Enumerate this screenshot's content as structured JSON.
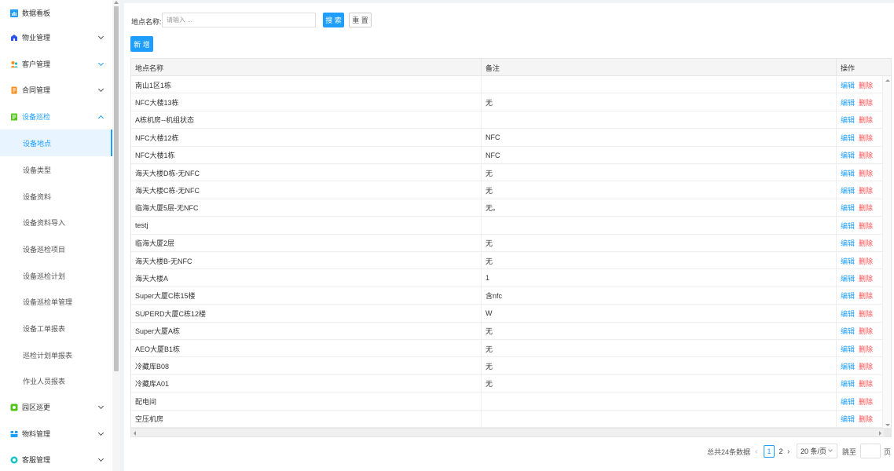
{
  "sidebar": {
    "items": [
      {
        "label": "数据看板",
        "icon": "chart-icon",
        "color": "#1e9fff",
        "chevron": "none"
      },
      {
        "label": "物业管理",
        "icon": "building-icon",
        "color": "#2f54eb",
        "chevron": "down"
      },
      {
        "label": "客户管理",
        "icon": "users-icon",
        "color": "#13c2c2",
        "chevron": "down"
      },
      {
        "label": "合同管理",
        "icon": "contract-icon",
        "color": "#fa8c16",
        "chevron": "down"
      },
      {
        "label": "设备巡检",
        "icon": "inspect-icon",
        "color": "#52c41a",
        "chevron": "up"
      }
    ],
    "sub_items": [
      {
        "label": "设备地点",
        "active": true
      },
      {
        "label": "设备类型"
      },
      {
        "label": "设备资料"
      },
      {
        "label": "设备资料导入"
      },
      {
        "label": "设备巡检项目"
      },
      {
        "label": "设备巡检计划"
      },
      {
        "label": "设备巡检单管理"
      },
      {
        "label": "设备工单报表"
      },
      {
        "label": "巡检计划单报表"
      },
      {
        "label": "作业人员报表"
      }
    ],
    "bottom_items": [
      {
        "label": "园区巡更",
        "icon": "patrol-icon",
        "color": "#52c41a"
      },
      {
        "label": "物料管理",
        "icon": "material-icon",
        "color": "#1e9fff"
      },
      {
        "label": "客服管理",
        "icon": "service-icon",
        "color": "#13c2c2"
      }
    ]
  },
  "search": {
    "label": "地点名称:",
    "placeholder": "请输入 ...",
    "search_button": "搜 索",
    "reset_button": "重 置"
  },
  "toolbar": {
    "add_button": "新 增"
  },
  "table": {
    "headers": [
      "地点名称",
      "备注",
      "操作"
    ],
    "edit_label": "编辑",
    "delete_label": "删除",
    "rows": [
      [
        "南山1区1栋",
        ""
      ],
      [
        "NFC大楼13栋",
        "无"
      ],
      [
        "A栋机房--机组状态",
        ""
      ],
      [
        "NFC大楼12栋",
        "NFC"
      ],
      [
        "NFC大楼1栋",
        "NFC"
      ],
      [
        "海天大楼D栋-无NFC",
        "无"
      ],
      [
        "海天大楼C栋-无NFC",
        "无"
      ],
      [
        "临海大厦5层-无NFC",
        "无。"
      ],
      [
        "testj",
        ""
      ],
      [
        "临海大厦2层",
        "无"
      ],
      [
        "海天大楼B-无NFC",
        "无"
      ],
      [
        "海天大楼A",
        "1"
      ],
      [
        "Super大厦C栋15楼",
        "含nfc"
      ],
      [
        "SUPERD大厦C栋12楼",
        "W"
      ],
      [
        "Super大厦A栋",
        "无"
      ],
      [
        "AEO大厦B1栋",
        "无"
      ],
      [
        "冷藏库B08",
        "无"
      ],
      [
        "冷藏库A01",
        "无"
      ],
      [
        "配电间",
        ""
      ],
      [
        "空压机房",
        ""
      ]
    ]
  },
  "pagination": {
    "total_text": "总共24条数据",
    "pages": [
      "1",
      "2"
    ],
    "current_page": "1",
    "page_size": "20 条/页",
    "goto_label": "跳至",
    "unit_label": "页",
    "prev": "‹",
    "next": "›"
  },
  "colors": {
    "primary": "#1e9fff",
    "danger": "#ff4d4f"
  }
}
